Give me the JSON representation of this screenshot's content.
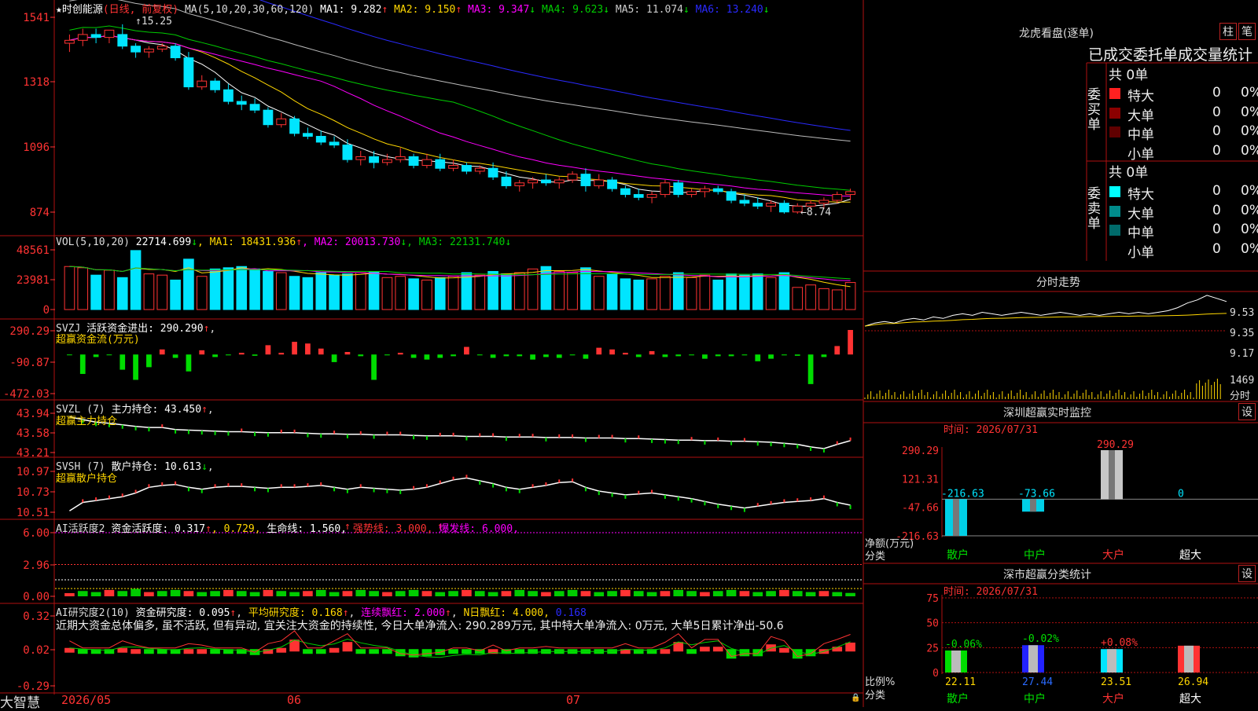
{
  "colors": {
    "up": "#ff3333",
    "down": "#00e5ff",
    "ma1": "#ffffff",
    "ma2": "#ffd700",
    "ma3": "#ff00ff",
    "ma4": "#00cc00",
    "ma5": "#bbbbbb",
    "ma6": "#2a2aff",
    "grid": "#b01010"
  },
  "stock": {
    "name": "★时创能源",
    "period": "(日线, 前复权)"
  },
  "price_panel": {
    "ma_label": "MA(5,10,20,30,60,120)",
    "ma": [
      {
        "label": "MA1: 9.282",
        "arrow": "↑",
        "color": "#ffffff"
      },
      {
        "label": "MA2: 9.150",
        "arrow": "↑",
        "color": "#ffd700"
      },
      {
        "label": "MA3: 9.347",
        "arrow": "↓",
        "color": "#ff00ff"
      },
      {
        "label": "MA4: 9.623",
        "arrow": "↓",
        "color": "#00cc00"
      },
      {
        "label": "MA5: 11.074",
        "arrow": "↓",
        "color": "#cccccc"
      },
      {
        "label": "MA6: 13.240",
        "arrow": "↓",
        "color": "#2a2aff"
      }
    ],
    "y_ticks": [
      "1541",
      "1318",
      "1096",
      "874"
    ],
    "high_label": "15.25",
    "low_label": "8.74"
  },
  "vol_panel": {
    "label": "VOL(5,10,20)",
    "value": "22714.699",
    "arrow": "↓",
    "ma": [
      {
        "label": "MA1: 18431.936",
        "arrow": "↑",
        "color": "#ffd700"
      },
      {
        "label": "MA2: 20013.730",
        "arrow": "↓",
        "color": "#ff00ff"
      },
      {
        "label": "MA3: 22131.740",
        "arrow": "↓",
        "color": "#00cc00"
      }
    ],
    "y_ticks": [
      "48561",
      "23981",
      "0"
    ]
  },
  "svzj_panel": {
    "label": "SVZJ",
    "text": "活跃资金进出: 290.290",
    "arrow": "↑",
    "sub": "超赢资金流(万元)",
    "y_ticks": [
      "290.29",
      "-90.87",
      "-472.03"
    ]
  },
  "svzl_panel": {
    "label": "SVZL (7)",
    "text": "主力持仓: 43.450",
    "arrow": "↑",
    "sub": "超赢主力持仓",
    "y_ticks": [
      "43.94",
      "43.58",
      "43.21"
    ]
  },
  "svsh_panel": {
    "label": "SVSH (7)",
    "text": "散户持仓: 10.613",
    "arrow": "↓",
    "sub": "超赢散户持仓",
    "y_ticks": [
      "10.97",
      "10.73",
      "10.51"
    ]
  },
  "ai_active": {
    "label": "AI活跃度2",
    "text": "资金活跃度: 0.317",
    "arrow1": "↑",
    "val2": ", 0.729,",
    "life": " 生命线: 1.560,",
    "strong": " 强势线: 3.000,",
    "burst": " 爆发线: 6.000,",
    "y_ticks": [
      "6.00",
      "2.96",
      "0.00"
    ]
  },
  "ai_research": {
    "label": "AI研究度2(10)",
    "text": "资金研究度: 0.095",
    "arrow1": "↑",
    "avg": " 平均研究度: 0.168",
    "arrow2": "↑",
    "cont": " 连续飘红: 2.000",
    "arrow3": "↑",
    "nday": " N日飘红: 4.000,",
    "last": " 0.168",
    "note": "近期大资金总体偏多, 虽不活跃, 但有异动, 宜关注大资金的持续性, 今日大单净流入: 290.289万元, 其中特大单净流入: 0万元, 大单5日累计净出-50.6",
    "y_ticks": [
      "0.32",
      "0.02",
      "-0.29"
    ]
  },
  "x_axis": {
    "labels": [
      "2026/05",
      "06",
      "07"
    ]
  },
  "brand": "大智慧",
  "right": {
    "dragon_title": "龙虎看盘(逐单)",
    "btn_zhu": "柱",
    "btn_bi": "笔",
    "order_title": "已成交委托单成交量统计",
    "buy_side": "委买单",
    "sell_side": "委卖单",
    "buy_total": "共 0单",
    "sell_total": "共 0单",
    "rows": [
      {
        "label": "特大",
        "count": "0",
        "pct": "0%"
      },
      {
        "label": "大单",
        "count": "0",
        "pct": "0%"
      },
      {
        "label": "中单",
        "count": "0",
        "pct": "0%"
      },
      {
        "label": "小单",
        "count": "0",
        "pct": "0%"
      }
    ],
    "intraday_title": "分时走势",
    "intraday_ticks": [
      "9.53",
      "9.35",
      "9.17"
    ],
    "intraday_vol": "1469",
    "intraday_vol_label": "分时",
    "sz_title": "深圳超赢实时监控",
    "set_label": "设",
    "time_label": "时间: 2026/07/31",
    "net_label": "净额(万元)",
    "cat_label": "分类",
    "cat_title": "深市超赢分类统计",
    "ratio_label": "比例%",
    "categories": [
      "散户",
      "中户",
      "大户",
      "超大"
    ]
  },
  "chart_data": [
    {
      "type": "candlestick",
      "title": "★时创能源 (日线, 前复权)",
      "x_labels": [
        "2026/05",
        "06",
        "07"
      ],
      "ylim": [
        8.2,
        15.6
      ],
      "y_ticks": [
        15.41,
        13.18,
        10.96,
        8.74
      ],
      "annotations": [
        "15.25",
        "8.74"
      ],
      "series_ohlc": [
        [
          14.6,
          14.9,
          14.3,
          14.7
        ],
        [
          14.7,
          15.1,
          14.5,
          14.9
        ],
        [
          14.9,
          15.1,
          14.6,
          14.8
        ],
        [
          14.8,
          15.0,
          14.6,
          15.05
        ],
        [
          14.9,
          15.25,
          14.4,
          14.5
        ],
        [
          14.5,
          14.6,
          14.1,
          14.3
        ],
        [
          14.3,
          14.5,
          14.1,
          14.4
        ],
        [
          14.4,
          14.6,
          14.3,
          14.5
        ],
        [
          14.5,
          14.6,
          14.0,
          14.1
        ],
        [
          14.1,
          14.3,
          13.0,
          13.1
        ],
        [
          13.1,
          13.5,
          13.0,
          13.3
        ],
        [
          13.3,
          13.4,
          12.9,
          13.0
        ],
        [
          13.0,
          13.2,
          12.5,
          12.6
        ],
        [
          12.6,
          12.8,
          12.3,
          12.5
        ],
        [
          12.5,
          12.7,
          12.2,
          12.3
        ],
        [
          12.3,
          12.4,
          11.7,
          11.8
        ],
        [
          11.8,
          12.2,
          11.7,
          12.0
        ],
        [
          12.0,
          12.1,
          11.4,
          11.5
        ],
        [
          11.5,
          11.7,
          11.3,
          11.4
        ],
        [
          11.4,
          11.6,
          11.1,
          11.2
        ],
        [
          11.2,
          11.4,
          11.0,
          11.1
        ],
        [
          11.1,
          11.3,
          10.5,
          10.6
        ],
        [
          10.6,
          10.9,
          10.4,
          10.7
        ],
        [
          10.7,
          10.9,
          10.3,
          10.5
        ],
        [
          10.5,
          10.8,
          10.4,
          10.6
        ],
        [
          10.6,
          11.0,
          10.5,
          10.7
        ],
        [
          10.7,
          10.8,
          10.3,
          10.4
        ],
        [
          10.4,
          10.8,
          10.3,
          10.6
        ],
        [
          10.6,
          10.8,
          10.2,
          10.3
        ],
        [
          10.3,
          10.6,
          10.2,
          10.4
        ],
        [
          10.4,
          10.5,
          10.1,
          10.2
        ],
        [
          10.2,
          10.4,
          10.1,
          10.3
        ],
        [
          10.3,
          10.5,
          9.9,
          10.0
        ],
        [
          10.0,
          10.2,
          9.6,
          9.7
        ],
        [
          9.7,
          9.9,
          9.5,
          9.8
        ],
        [
          9.8,
          10.0,
          9.6,
          9.9
        ],
        [
          9.9,
          10.1,
          9.7,
          9.8
        ],
        [
          9.8,
          10.0,
          9.6,
          9.9
        ],
        [
          9.9,
          10.2,
          9.8,
          10.1
        ],
        [
          10.1,
          10.3,
          9.5,
          9.7
        ],
        [
          9.7,
          10.1,
          9.6,
          9.9
        ],
        [
          9.9,
          10.0,
          9.5,
          9.6
        ],
        [
          9.6,
          9.7,
          9.3,
          9.4
        ],
        [
          9.4,
          9.6,
          9.2,
          9.3
        ],
        [
          9.3,
          9.5,
          9.1,
          9.4
        ],
        [
          9.4,
          9.9,
          9.3,
          9.8
        ],
        [
          9.8,
          9.9,
          9.3,
          9.4
        ],
        [
          9.4,
          9.6,
          9.3,
          9.5
        ],
        [
          9.5,
          9.7,
          9.3,
          9.6
        ],
        [
          9.6,
          9.7,
          9.4,
          9.5
        ],
        [
          9.5,
          9.6,
          9.1,
          9.2
        ],
        [
          9.2,
          9.4,
          9.0,
          9.1
        ],
        [
          9.1,
          9.3,
          8.9,
          9.0
        ],
        [
          9.0,
          9.2,
          8.8,
          9.1
        ],
        [
          9.1,
          9.2,
          8.74,
          8.8
        ],
        [
          8.8,
          9.1,
          8.74,
          9.0
        ],
        [
          9.0,
          9.2,
          8.9,
          9.1
        ],
        [
          9.1,
          9.3,
          8.9,
          9.2
        ],
        [
          9.2,
          9.5,
          9.1,
          9.4
        ],
        [
          9.4,
          9.6,
          9.2,
          9.5
        ]
      ]
    },
    {
      "type": "bar",
      "name": "VOL",
      "ylim": [
        0,
        48561
      ],
      "values": [
        35000,
        34000,
        28000,
        32000,
        26000,
        48000,
        29000,
        28000,
        24000,
        41000,
        27000,
        33000,
        34000,
        35000,
        33000,
        31000,
        30000,
        27000,
        26000,
        30000,
        28000,
        29000,
        30000,
        31000,
        26000,
        27000,
        25000,
        24000,
        26000,
        27000,
        30000,
        28000,
        31000,
        29000,
        30000,
        33000,
        35000,
        31000,
        30000,
        34000,
        27000,
        29000,
        25000,
        24000,
        25000,
        27000,
        30000,
        26000,
        28000,
        24000,
        29000,
        28000,
        29000,
        26000,
        30000,
        18000,
        20000,
        17000,
        16000,
        22000
      ]
    },
    {
      "type": "bar",
      "name": "SVZJ",
      "ylim": [
        -472.03,
        290.29
      ],
      "values": [
        -2,
        -230,
        -30,
        -5,
        -180,
        -300,
        -150,
        60,
        -40,
        -200,
        50,
        -30,
        -10,
        20,
        -15,
        110,
        20,
        150,
        130,
        70,
        -90,
        30,
        -20,
        -300,
        -10,
        20,
        -40,
        -60,
        -40,
        -20,
        90,
        -10,
        -40,
        -20,
        -20,
        -60,
        -30,
        -40,
        -10,
        -50,
        80,
        60,
        20,
        -30,
        40,
        -30,
        -20,
        -10,
        -50,
        -20,
        -20,
        -10,
        -80,
        -50,
        -10,
        -15,
        -350,
        -30,
        100,
        290.29
      ]
    },
    {
      "type": "line",
      "name": "SVZL",
      "ylim": [
        43.21,
        43.94
      ],
      "values": [
        43.9,
        43.85,
        43.8,
        43.78,
        43.75,
        43.72,
        43.7,
        43.7,
        43.66,
        43.65,
        43.64,
        43.63,
        43.62,
        43.62,
        43.61,
        43.6,
        43.6,
        43.6,
        43.59,
        43.58,
        43.58,
        43.57,
        43.57,
        43.56,
        43.56,
        43.56,
        43.55,
        43.54,
        43.54,
        43.54,
        43.53,
        43.53,
        43.53,
        43.52,
        43.52,
        43.52,
        43.51,
        43.51,
        43.51,
        43.5,
        43.5,
        43.5,
        43.49,
        43.49,
        43.48,
        43.47,
        43.46,
        43.46,
        43.45,
        43.45,
        43.44,
        43.44,
        43.43,
        43.42,
        43.4,
        43.38,
        43.33,
        43.3,
        43.38,
        43.45
      ]
    },
    {
      "type": "line",
      "name": "SVSH",
      "ylim": [
        10.51,
        10.97
      ],
      "values": [
        10.55,
        10.64,
        10.66,
        10.68,
        10.7,
        10.74,
        10.8,
        10.82,
        10.83,
        10.8,
        10.78,
        10.8,
        10.81,
        10.81,
        10.8,
        10.79,
        10.8,
        10.8,
        10.81,
        10.82,
        10.8,
        10.78,
        10.8,
        10.79,
        10.78,
        10.77,
        10.78,
        10.8,
        10.84,
        10.88,
        10.9,
        10.87,
        10.84,
        10.8,
        10.78,
        10.8,
        10.82,
        10.85,
        10.86,
        10.8,
        10.76,
        10.74,
        10.72,
        10.73,
        10.74,
        10.72,
        10.7,
        10.68,
        10.65,
        10.62,
        10.6,
        10.58,
        10.6,
        10.62,
        10.64,
        10.65,
        10.66,
        10.68,
        10.64,
        10.61
      ]
    },
    {
      "type": "bar",
      "name": "AI活跃度2",
      "ylim": [
        0,
        6
      ],
      "values": [
        0.3,
        0.5,
        0.4,
        0.6,
        0.5,
        0.7,
        0.4,
        0.5,
        0.6,
        0.5,
        0.4,
        0.5,
        0.6,
        0.5,
        0.4,
        0.6,
        0.5,
        0.4,
        0.5,
        0.6,
        0.4,
        0.5,
        0.6,
        0.5,
        0.4,
        0.5,
        0.6,
        0.5,
        0.4,
        0.5,
        0.6,
        0.5,
        0.4,
        0.5,
        0.6,
        0.5,
        0.4,
        0.5,
        0.6,
        0.5,
        0.4,
        0.5,
        0.6,
        0.5,
        0.4,
        0.5,
        0.6,
        0.5,
        0.4,
        0.5,
        0.6,
        0.5,
        0.4,
        0.5,
        0.6,
        0.5,
        0.4,
        0.5,
        0.4,
        0.317
      ]
    },
    {
      "type": "bar",
      "name": "AI研究度2(10)",
      "ylim": [
        -0.29,
        0.32
      ],
      "values": [
        0.05,
        0.0,
        0.0,
        0.0,
        0.05,
        0.02,
        0.0,
        0.0,
        0.0,
        0.03,
        0.02,
        0.0,
        0.0,
        0.0,
        -0.03,
        0.03,
        0.05,
        0.12,
        0.0,
        0.0,
        0.05,
        0.1,
        0.0,
        0.0,
        0.0,
        -0.04,
        -0.05,
        -0.04,
        -0.03,
        0.0,
        0.0,
        -0.02,
        0.02,
        -0.02,
        0.0,
        0.0,
        0.01,
        0.0,
        0.0,
        0.0,
        0.0,
        0.0,
        0.03,
        0.0,
        0.0,
        0.04,
        0.1,
        0.0,
        0.06,
        0.06,
        -0.06,
        -0.04,
        -0.04,
        0.08,
        0.05,
        -0.06,
        -0.04,
        0.03,
        0.06,
        0.095
      ]
    },
    {
      "type": "line",
      "name": "分时走势",
      "ylim": [
        9.1,
        9.6
      ],
      "y_ticks": [
        9.53,
        9.35,
        9.17
      ],
      "values": [
        9.38,
        9.4,
        9.41,
        9.4,
        9.42,
        9.43,
        9.42,
        9.44,
        9.43,
        9.45,
        9.46,
        9.45,
        9.47,
        9.46,
        9.45,
        9.46,
        9.47,
        9.46,
        9.45,
        9.46,
        9.47,
        9.46,
        9.45,
        9.46,
        9.45,
        9.46,
        9.47,
        9.46,
        9.47,
        9.46,
        9.47,
        9.48,
        9.5,
        9.53,
        9.55,
        9.58,
        9.56,
        9.54
      ]
    },
    {
      "type": "bar",
      "name": "深圳超赢实时监控",
      "categories": [
        "散户",
        "中户",
        "大户",
        "超大"
      ],
      "values": [
        -216.63,
        -73.66,
        290.29,
        0
      ],
      "ylim": [
        -216.63,
        290.29
      ],
      "y_ticks": [
        290.29,
        121.31,
        -47.66,
        -216.63
      ]
    },
    {
      "type": "bar",
      "name": "深市超赢分类统计",
      "categories": [
        "散户",
        "中户",
        "大户",
        "超大"
      ],
      "values": [
        22.11,
        27.44,
        23.51,
        26.94
      ],
      "changes": [
        "-0.06%",
        "-0.02%",
        "+0.08%",
        ""
      ],
      "ylim": [
        0,
        75
      ],
      "y_ticks": [
        75,
        50,
        25,
        0
      ]
    }
  ]
}
